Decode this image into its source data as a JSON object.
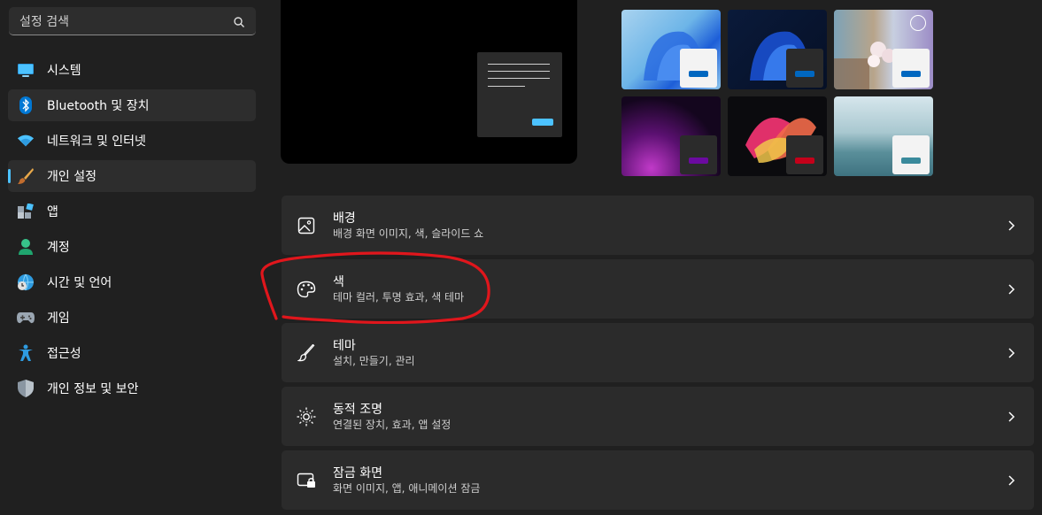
{
  "search": {
    "placeholder": "설정 검색",
    "icon": "search-icon"
  },
  "nav": {
    "items": [
      {
        "label": "시스템",
        "icon": "monitor-icon"
      },
      {
        "label": "Bluetooth 및 장치",
        "icon": "bluetooth-icon",
        "state": "hover"
      },
      {
        "label": "네트워크 및 인터넷",
        "icon": "wifi-icon"
      },
      {
        "label": "개인 설정",
        "icon": "brush-icon",
        "state": "selected"
      },
      {
        "label": "앱",
        "icon": "apps-icon"
      },
      {
        "label": "계정",
        "icon": "person-icon"
      },
      {
        "label": "시간 및 언어",
        "icon": "globe-clock-icon"
      },
      {
        "label": "게임",
        "icon": "gamepad-icon"
      },
      {
        "label": "접근성",
        "icon": "accessibility-icon"
      },
      {
        "label": "개인 정보 및 보안",
        "icon": "shield-icon"
      }
    ]
  },
  "themes": [
    {
      "name": "windows-light",
      "bar_color": "#0067c0"
    },
    {
      "name": "windows-dark",
      "bar_color": "#0067c0"
    },
    {
      "name": "glow",
      "bar_color": "#0067c0"
    },
    {
      "name": "captured-motion",
      "bar_color": "#6b0aa0"
    },
    {
      "name": "flow",
      "bar_color": "#c4001a"
    },
    {
      "name": "sunrise",
      "bar_color": "#3a8a9c"
    }
  ],
  "cards": [
    {
      "title": "배경",
      "subtitle": "배경 화면 이미지, 색, 슬라이드 쇼",
      "icon": "image-icon"
    },
    {
      "title": "색",
      "subtitle": "테마 컬러, 투명 효과, 색 테마",
      "icon": "palette-icon"
    },
    {
      "title": "테마",
      "subtitle": "설치, 만들기, 관리",
      "icon": "brush-icon"
    },
    {
      "title": "동적 조명",
      "subtitle": "연결된 장치, 효과, 앱 설정",
      "icon": "dynamic-lighting-icon"
    },
    {
      "title": "잠금 화면",
      "subtitle": "화면 이미지, 앱, 애니메이션 잠금",
      "icon": "lock-screen-icon"
    }
  ],
  "colors": {
    "accent": "#4cc2ff",
    "annotation": "#e0161c"
  }
}
